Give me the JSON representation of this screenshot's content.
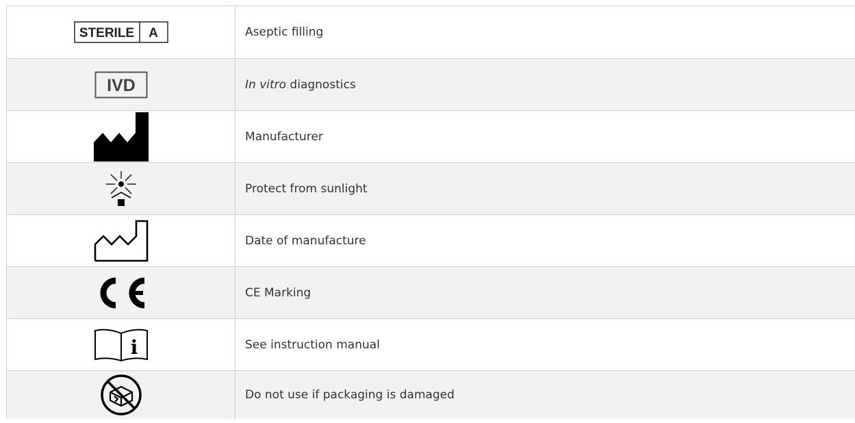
{
  "symbols": [
    {
      "symbol": "sterile-a-icon",
      "symbol_text_1": "STERILE",
      "symbol_text_2": "A",
      "description": "Aseptic filling"
    },
    {
      "symbol": "ivd-icon",
      "symbol_text": "IVD",
      "description_italic": "In vitro",
      "description_rest": " diagnostics"
    },
    {
      "symbol": "manufacturer-icon",
      "description": "Manufacturer"
    },
    {
      "symbol": "protect-from-sunlight-icon",
      "description": "Protect from sunlight"
    },
    {
      "symbol": "date-of-manufacture-icon",
      "description": "Date of manufacture"
    },
    {
      "symbol": "ce-marking-icon",
      "description": "CE Marking"
    },
    {
      "symbol": "instruction-manual-icon",
      "description": "See instruction manual"
    },
    {
      "symbol": "do-not-use-if-damaged-icon",
      "description": "Do not use if packaging is damaged"
    }
  ],
  "colors": {
    "border": "#cfcfcf",
    "row_shade": "#f2f2f2",
    "text": "#333333",
    "symbol": "#000000"
  }
}
